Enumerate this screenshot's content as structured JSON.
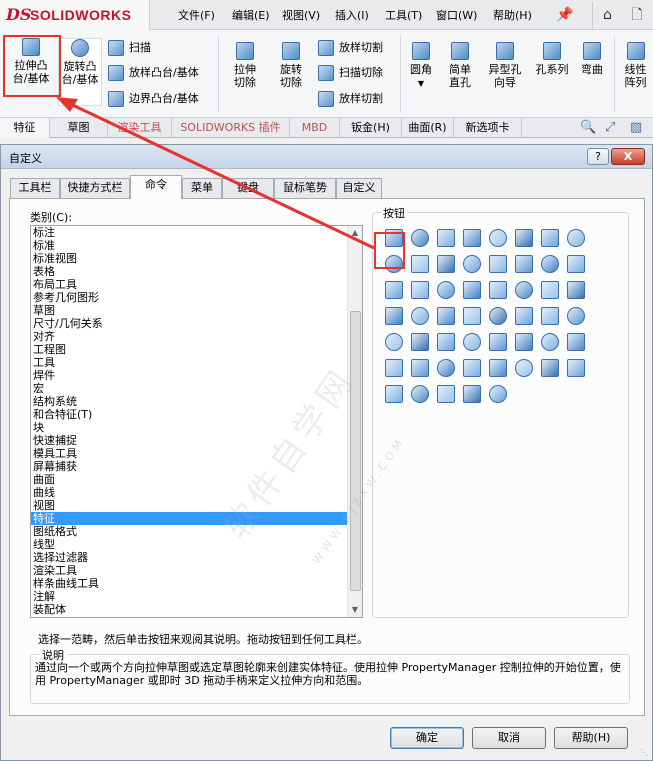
{
  "app": {
    "logo_ds": "DS",
    "logo_text": "SOLIDWORKS"
  },
  "menu": {
    "items": [
      "文件(F)",
      "编辑(E)",
      "视图(V)",
      "插入(I)",
      "工具(T)",
      "窗口(W)",
      "帮助(H)"
    ]
  },
  "ribbon": {
    "extrude_boss": "拉伸凸台/基体",
    "revolve_boss": "旋转凸台/基体",
    "sweep": "扫描",
    "loft": "放样凸台/基体",
    "boundary": "边界凸台/基体",
    "extrude_cut": "拉伸切除",
    "revolve_cut": "旋转切除",
    "loft_cut": "放样切割",
    "sweep_cut": "扫描切除",
    "boundary_cut": "放样切割",
    "fillet": "圆角",
    "simple_hole": "简单直孔",
    "hole_wizard": "异型孔向导",
    "hole_series": "孔系列",
    "flex": "弯曲",
    "linear_pattern": "线性阵列"
  },
  "ribbon_tabs": [
    "特征",
    "草图",
    "渲染工具",
    "SOLIDWORKS 插件",
    "MBD",
    "钣金(H)",
    "曲面(R)",
    "新选项卡"
  ],
  "dialog": {
    "title": "自定义",
    "help_btn": "?",
    "close_btn": "X",
    "tabs": [
      "工具栏",
      "快捷方式栏",
      "命令",
      "菜单",
      "键盘",
      "鼠标笔势",
      "自定义"
    ],
    "category_label": "类别(C):",
    "categories": [
      "标注",
      "标准",
      "标准视图",
      "表格",
      "布局工具",
      "参考几何图形",
      "草图",
      "尺寸/几何关系",
      "对齐",
      "工程图",
      "工具",
      "焊件",
      "宏",
      "结构系统",
      "和合特征(T)",
      "块",
      "快速捕捉",
      "模具工具",
      "屏幕捕获",
      "曲面",
      "曲线",
      "视图",
      "特征",
      "图纸格式",
      "线型",
      "选择过滤器",
      "渲染工具",
      "样条曲线工具",
      "注解",
      "装配体"
    ],
    "selected_category": "特征",
    "buttons_label": "按钮",
    "hint": "选择一范畴，然后单击按钮来观阅其说明。拖动按钮到任何工具栏。",
    "desc_label": "说明",
    "desc_text": "通过向一个或两个方向拉伸草图或选定草图轮廓来创建实体特征。使用拉伸 PropertyManager 控制拉伸的开始位置，使用 PropertyManager 或即时 3D 拖动手柄来定义拉伸方向和范围。",
    "ok": "确定",
    "cancel": "取消",
    "help": "帮助(H)"
  },
  "watermark": {
    "main": "软件自学网",
    "sub": "WWW.RJZXW.COM"
  },
  "colors": {
    "accent": "#3399ff",
    "brand": "#c8102e",
    "highlight": "#e8322c"
  },
  "grid_rows": [
    [
      "extrude-icon",
      "revolve-icon",
      "sweep-icon",
      "loft-icon",
      "boundary-icon",
      "extrude-cut-icon",
      "revolve-cut-icon",
      "sweep-cut-icon"
    ],
    [
      "loft-cut-icon",
      "boundary-cut-icon",
      "fillet-icon",
      "chamfer-icon",
      "rib-icon",
      "draft-icon",
      "shell-icon",
      "wrap-icon"
    ],
    [
      "dome-icon",
      "mirror-icon",
      "shape-icon",
      "hole-icon",
      "hole-wizard-icon",
      "flex-icon",
      "deform-icon",
      "indent-icon"
    ],
    [
      "split-icon",
      "cavity-icon",
      "scale-icon",
      "thread-icon",
      "combine-icon",
      "intersect-icon",
      "move-face-icon",
      "delete-face-icon"
    ],
    [
      "linear-pattern-icon",
      "circular-pattern-icon",
      "curve-pattern-icon",
      "sketch-pattern-icon",
      "table-pattern-icon",
      "fill-pattern-icon",
      "variable-pattern-icon",
      "mirror-pattern-icon"
    ],
    [
      "library-icon",
      "smart-icon",
      "freeform-icon",
      "instant3d-icon",
      "move-copy-icon",
      "surface-cut-icon",
      "body-delete-icon",
      "check-icon"
    ],
    [
      "grid-3d-icon",
      "cut-list-icon",
      "weldment-icon",
      "box-icon",
      "sheet-icon"
    ]
  ]
}
